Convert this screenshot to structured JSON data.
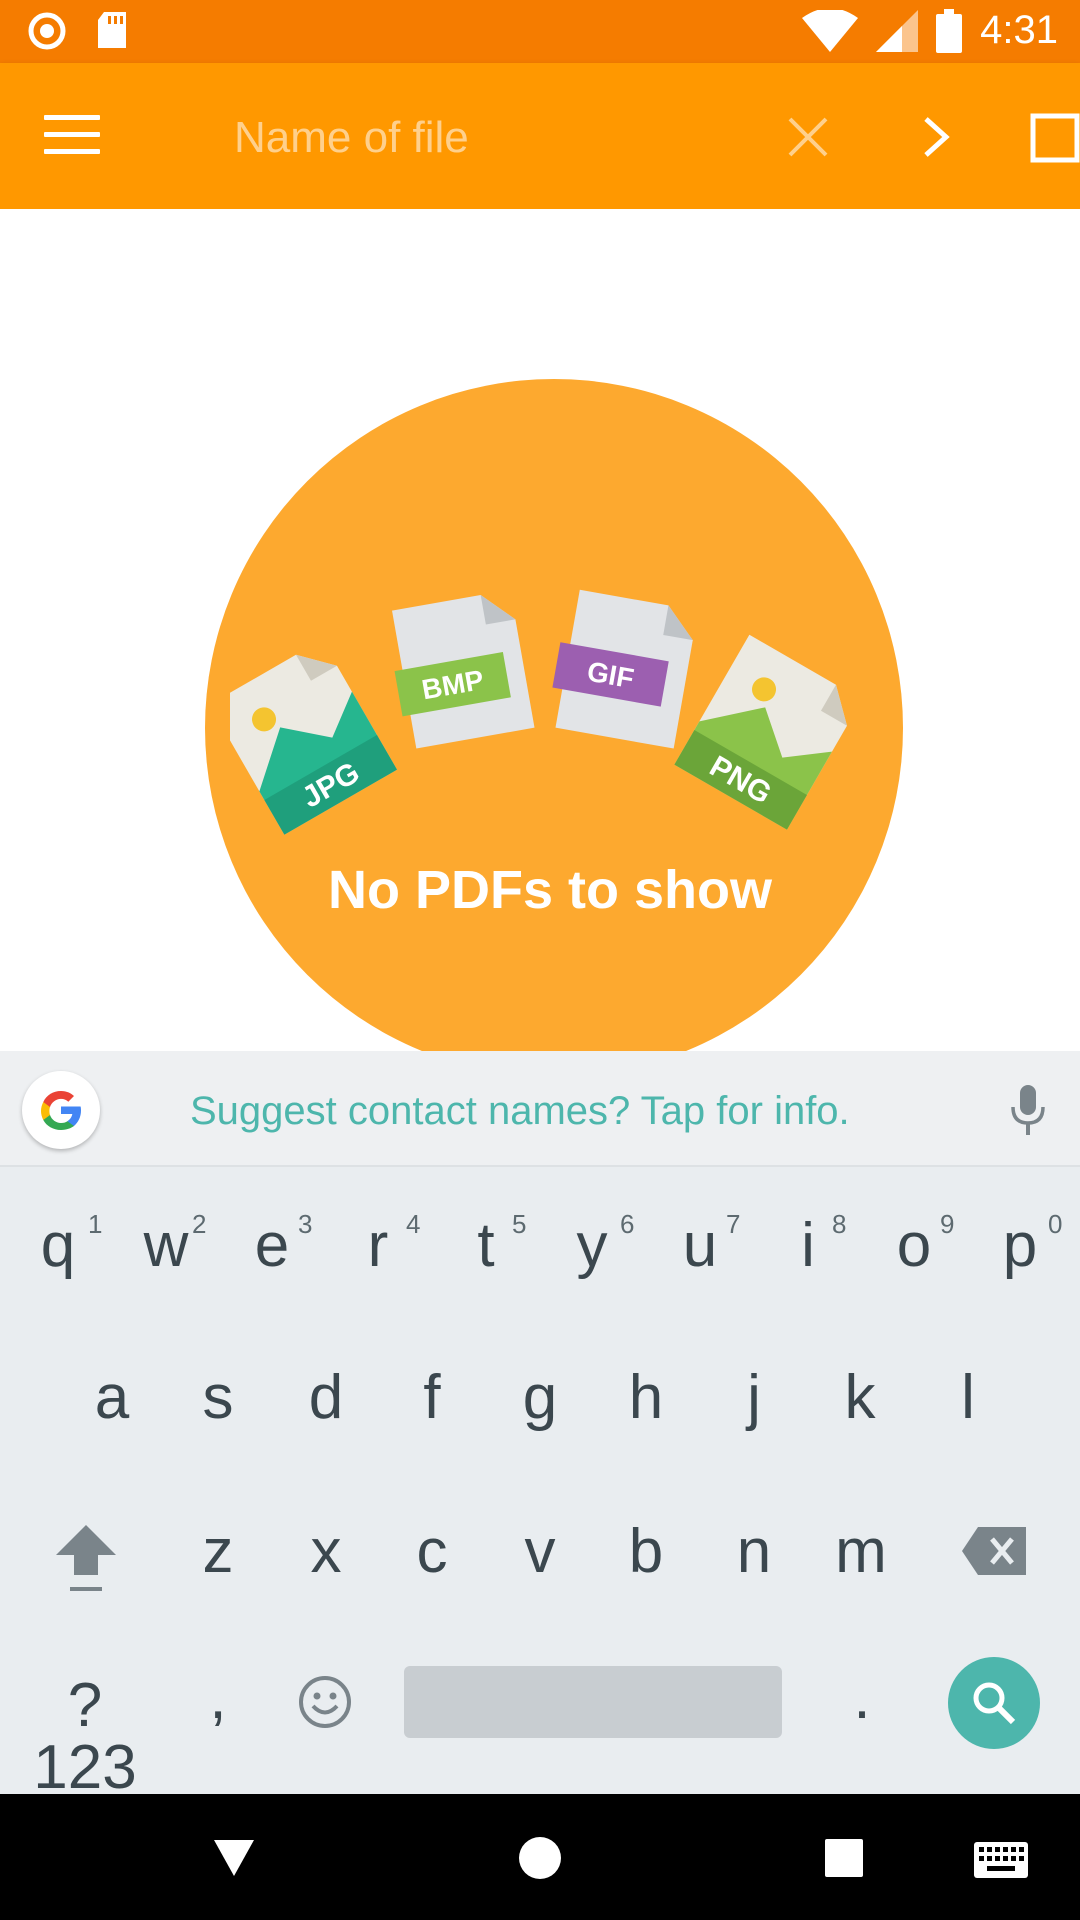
{
  "status_bar": {
    "time": "4:31",
    "icons": [
      "record-icon",
      "sd-card-icon",
      "wifi-icon",
      "signal-icon",
      "battery-icon"
    ]
  },
  "toolbar": {
    "search_placeholder": "Name of file",
    "icons": [
      "menu-icon",
      "clear-icon",
      "chevron-right-icon",
      "square-icon"
    ]
  },
  "empty_state": {
    "message": "No PDFs to show",
    "file_badges": [
      "JPG",
      "BMP",
      "GIF",
      "PNG"
    ]
  },
  "suggestion_strip": {
    "text": "Suggest contact names? Tap for info."
  },
  "keyboard": {
    "row1": [
      {
        "char": "q",
        "hint": "1"
      },
      {
        "char": "w",
        "hint": "2"
      },
      {
        "char": "e",
        "hint": "3"
      },
      {
        "char": "r",
        "hint": "4"
      },
      {
        "char": "t",
        "hint": "5"
      },
      {
        "char": "y",
        "hint": "6"
      },
      {
        "char": "u",
        "hint": "7"
      },
      {
        "char": "i",
        "hint": "8"
      },
      {
        "char": "o",
        "hint": "9"
      },
      {
        "char": "p",
        "hint": "0"
      }
    ],
    "row2": [
      "a",
      "s",
      "d",
      "f",
      "g",
      "h",
      "j",
      "k",
      "l"
    ],
    "row3": [
      "z",
      "x",
      "c",
      "v",
      "b",
      "n",
      "m"
    ],
    "symbols_label": "?123",
    "comma": ",",
    "period": "."
  },
  "colors": {
    "status_bar": "#F57C00",
    "toolbar": "#FF9800",
    "empty_circle": "#FDA92F",
    "accent_teal": "#4DB6AC",
    "keyboard_bg": "#E9EDF0"
  }
}
